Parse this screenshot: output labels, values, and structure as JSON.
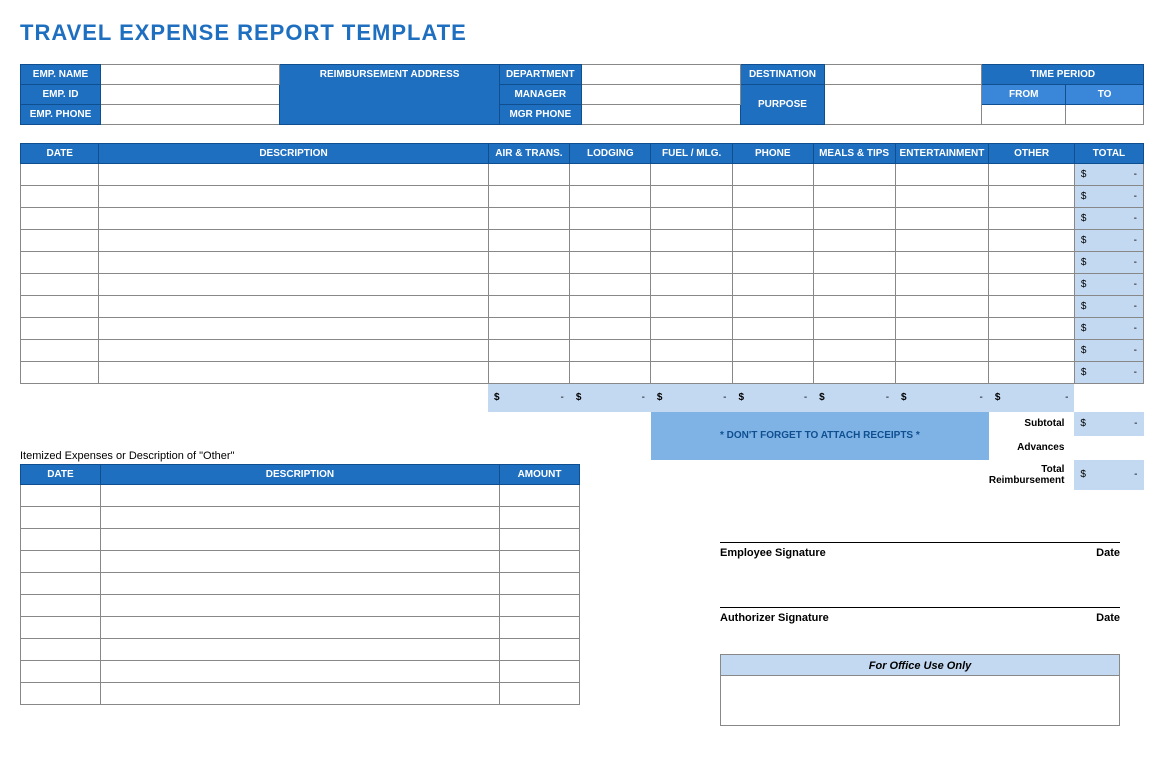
{
  "title": "TRAVEL EXPENSE REPORT TEMPLATE",
  "info": {
    "emp_name": "EMP. NAME",
    "emp_id": "EMP. ID",
    "emp_phone": "EMP. PHONE",
    "reimb_addr": "REIMBURSEMENT ADDRESS",
    "department": "DEPARTMENT",
    "manager": "MANAGER",
    "mgr_phone": "MGR PHONE",
    "destination": "DESTINATION",
    "purpose": "PURPOSE",
    "time_period": "TIME PERIOD",
    "from": "FROM",
    "to": "TO"
  },
  "main_headers": {
    "date": "DATE",
    "desc": "DESCRIPTION",
    "air": "AIR & TRANS.",
    "lodging": "LODGING",
    "fuel": "FUEL / MLG.",
    "phone": "PHONE",
    "meals": "MEALS & TIPS",
    "ent": "ENTERTAINMENT",
    "other": "OTHER",
    "total": "TOTAL"
  },
  "currency_symbol": "$",
  "empty_dash": "-",
  "main_rows": 10,
  "summary": {
    "subtotal": "Subtotal",
    "advances": "Advances",
    "total_reimb": "Total Reimbursement"
  },
  "attach_note": "* DON'T FORGET TO ATTACH RECEIPTS *",
  "itemized_caption": "Itemized Expenses or Description of \"Other\"",
  "itemized_headers": {
    "date": "DATE",
    "desc": "DESCRIPTION",
    "amount": "AMOUNT"
  },
  "itemized_rows": 10,
  "sig": {
    "emp": "Employee Signature",
    "auth": "Authorizer Signature",
    "date": "Date"
  },
  "office": "For Office Use Only"
}
